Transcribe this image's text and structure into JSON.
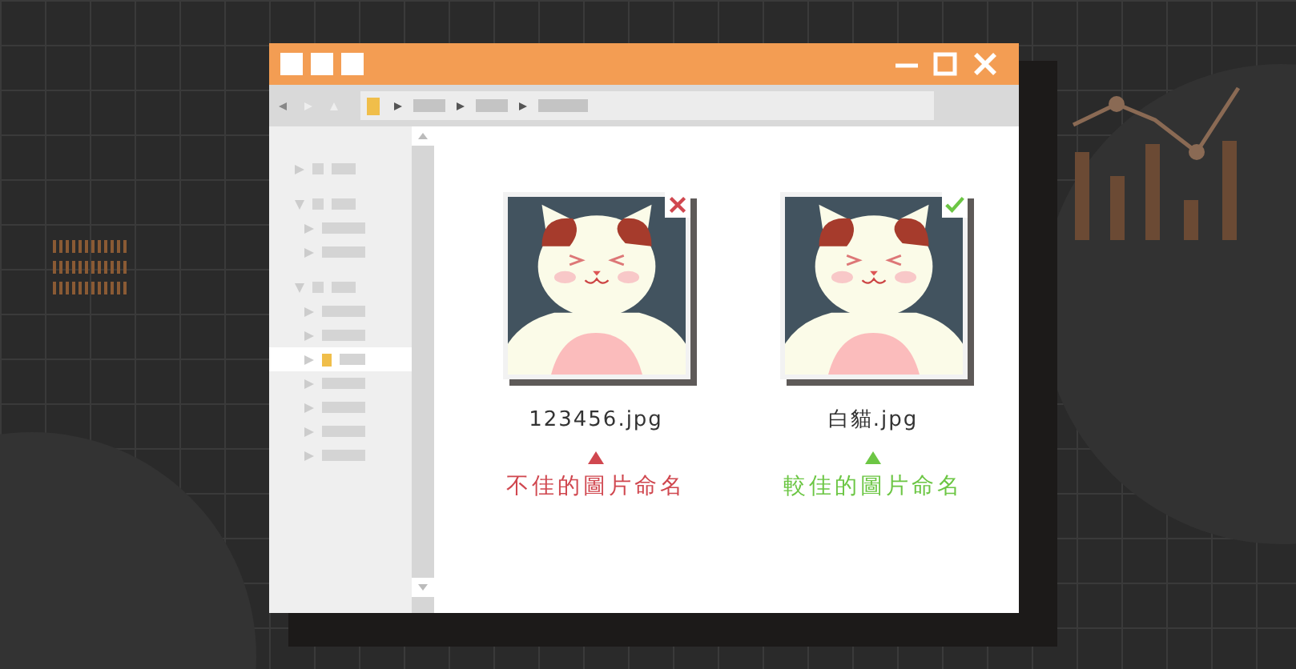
{
  "sidebar": {
    "tree": [
      {
        "expanded": false,
        "selected": false
      },
      {
        "expanded": true,
        "selected": false,
        "children": [
          {
            "expanded": false,
            "selected": false
          },
          {
            "expanded": false,
            "selected": false
          }
        ]
      },
      {
        "expanded": true,
        "selected": false,
        "children": [
          {
            "expanded": false,
            "selected": false
          },
          {
            "expanded": false,
            "selected": false
          },
          {
            "expanded": false,
            "selected": true
          },
          {
            "expanded": false,
            "selected": false
          },
          {
            "expanded": false,
            "selected": false
          },
          {
            "expanded": false,
            "selected": false
          },
          {
            "expanded": false,
            "selected": false
          }
        ]
      }
    ]
  },
  "files": [
    {
      "name": "123456.jpg",
      "kind": "bad",
      "caption": "不佳的圖片命名",
      "color": "#d0474f"
    },
    {
      "name": "白貓.jpg",
      "kind": "good",
      "caption": "較佳的圖片命名",
      "color": "#6cc644"
    }
  ]
}
